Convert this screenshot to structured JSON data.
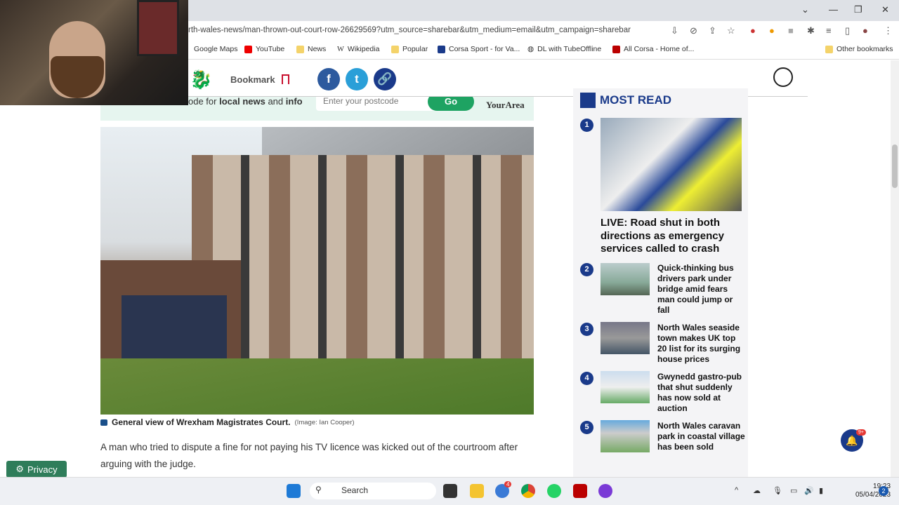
{
  "browser": {
    "url": "rth-wales-news/man-thrown-out-court-row-26629569?utm_source=sharebar&utm_medium=email&utm_campaign=sharebar",
    "bookmarks": [
      "Google Maps",
      "YouTube",
      "News",
      "Wikipedia",
      "Popular",
      "Corsa Sport - for Va...",
      "DL with TubeOffline",
      "All Corsa - Home of...",
      "Other bookmarks"
    ]
  },
  "header": {
    "bookmark_label": "Bookmark"
  },
  "postcode": {
    "text_pre": "ode for ",
    "b1": "local news",
    "mid": " and ",
    "b2": "info",
    "placeholder": "Enter your postcode",
    "go": "Go",
    "brand": "YourArea"
  },
  "photo": {
    "caption": "General view of Wrexham Magistrates Court.",
    "credit": "(Image: Ian Cooper)"
  },
  "article": {
    "para": "A man who tried to dispute a fine for not paying his TV licence was kicked out of the courtroom after arguing with the judge."
  },
  "most_read": {
    "title": "MOST READ",
    "items": [
      {
        "n": "1",
        "title": "LIVE: Road shut in both directions as emergency services called to crash"
      },
      {
        "n": "2",
        "title": "Quick-thinking bus drivers park under bridge amid fears man could jump or fall"
      },
      {
        "n": "3",
        "title": "North Wales seaside town makes UK top 20 list for its surging house prices"
      },
      {
        "n": "4",
        "title": "Gwynedd gastro-pub that shut suddenly has now sold at auction"
      },
      {
        "n": "5",
        "title": "North Wales caravan park in coastal village has been sold"
      }
    ]
  },
  "privacy": "Privacy",
  "notification_badge": "9+",
  "taskbar": {
    "search": "Search",
    "time": "19:23",
    "date": "05/04/2023",
    "thunderbird_badge": "4",
    "notif_count": "2"
  }
}
